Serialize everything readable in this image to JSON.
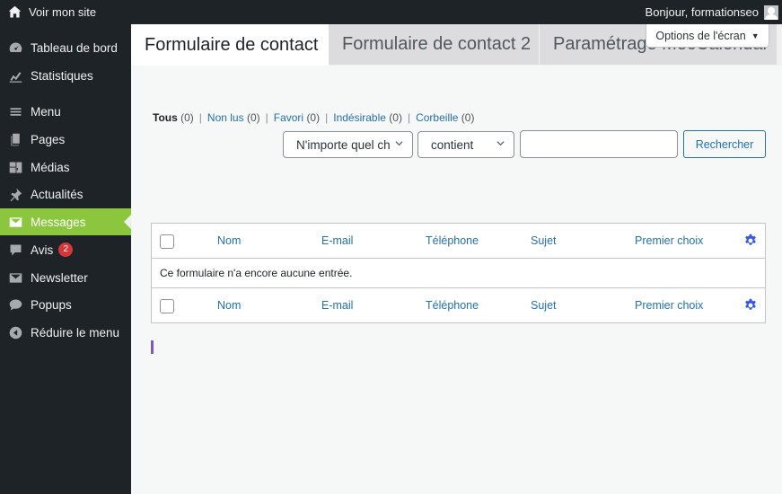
{
  "adminbar": {
    "site_label": "Voir mon site",
    "site_icon": "home-icon",
    "greeting": "Bonjour, formationseo",
    "avatar_icon": "avatar-icon"
  },
  "sidebar": {
    "items": [
      {
        "label": "Tableau de bord",
        "icon": "dashboard-icon"
      },
      {
        "label": "Statistiques",
        "icon": "chart-icon"
      },
      {
        "label": "Menu",
        "icon": "menu-icon"
      },
      {
        "label": "Pages",
        "icon": "pages-icon"
      },
      {
        "label": "Médias",
        "icon": "media-icon"
      },
      {
        "label": "Actualités",
        "icon": "pin-icon"
      },
      {
        "label": "Messages",
        "icon": "mail-icon",
        "active": true
      },
      {
        "label": "Avis",
        "icon": "comment-icon",
        "badge": "2"
      },
      {
        "label": "Newsletter",
        "icon": "mail-icon"
      },
      {
        "label": "Popups",
        "icon": "chat-icon"
      },
      {
        "label": "Réduire le menu",
        "icon": "collapse-icon"
      }
    ]
  },
  "screen_options": {
    "label": "Options de l'écran",
    "caret": "▼"
  },
  "tabs": [
    {
      "label": "Formulaire de contact",
      "active": true
    },
    {
      "label": "Formulaire de contact 2"
    },
    {
      "label": "Paramétrage MecCalendar"
    }
  ],
  "subsubsub": [
    {
      "label": "Tous",
      "count": "(0)",
      "current": true
    },
    {
      "label": "Non lus",
      "count": "(0)"
    },
    {
      "label": "Favori",
      "count": "(0)"
    },
    {
      "label": "Indésirable",
      "count": "(0)"
    },
    {
      "label": "Corbeille",
      "count": "(0)"
    }
  ],
  "filters": {
    "field_select": "N'importe quel ch",
    "operator_select": "contient",
    "search_value": "",
    "search_button": "Rechercher"
  },
  "table": {
    "columns": [
      "Nom",
      "E-mail",
      "Téléphone",
      "Sujet",
      "Premier choix"
    ],
    "empty_message": "Ce formulaire n'a encore aucune entrée."
  },
  "colors": {
    "admin_dark": "#1d2327",
    "active_menu": "#8cc63f",
    "link": "#2271b1",
    "badge": "#d63638"
  }
}
